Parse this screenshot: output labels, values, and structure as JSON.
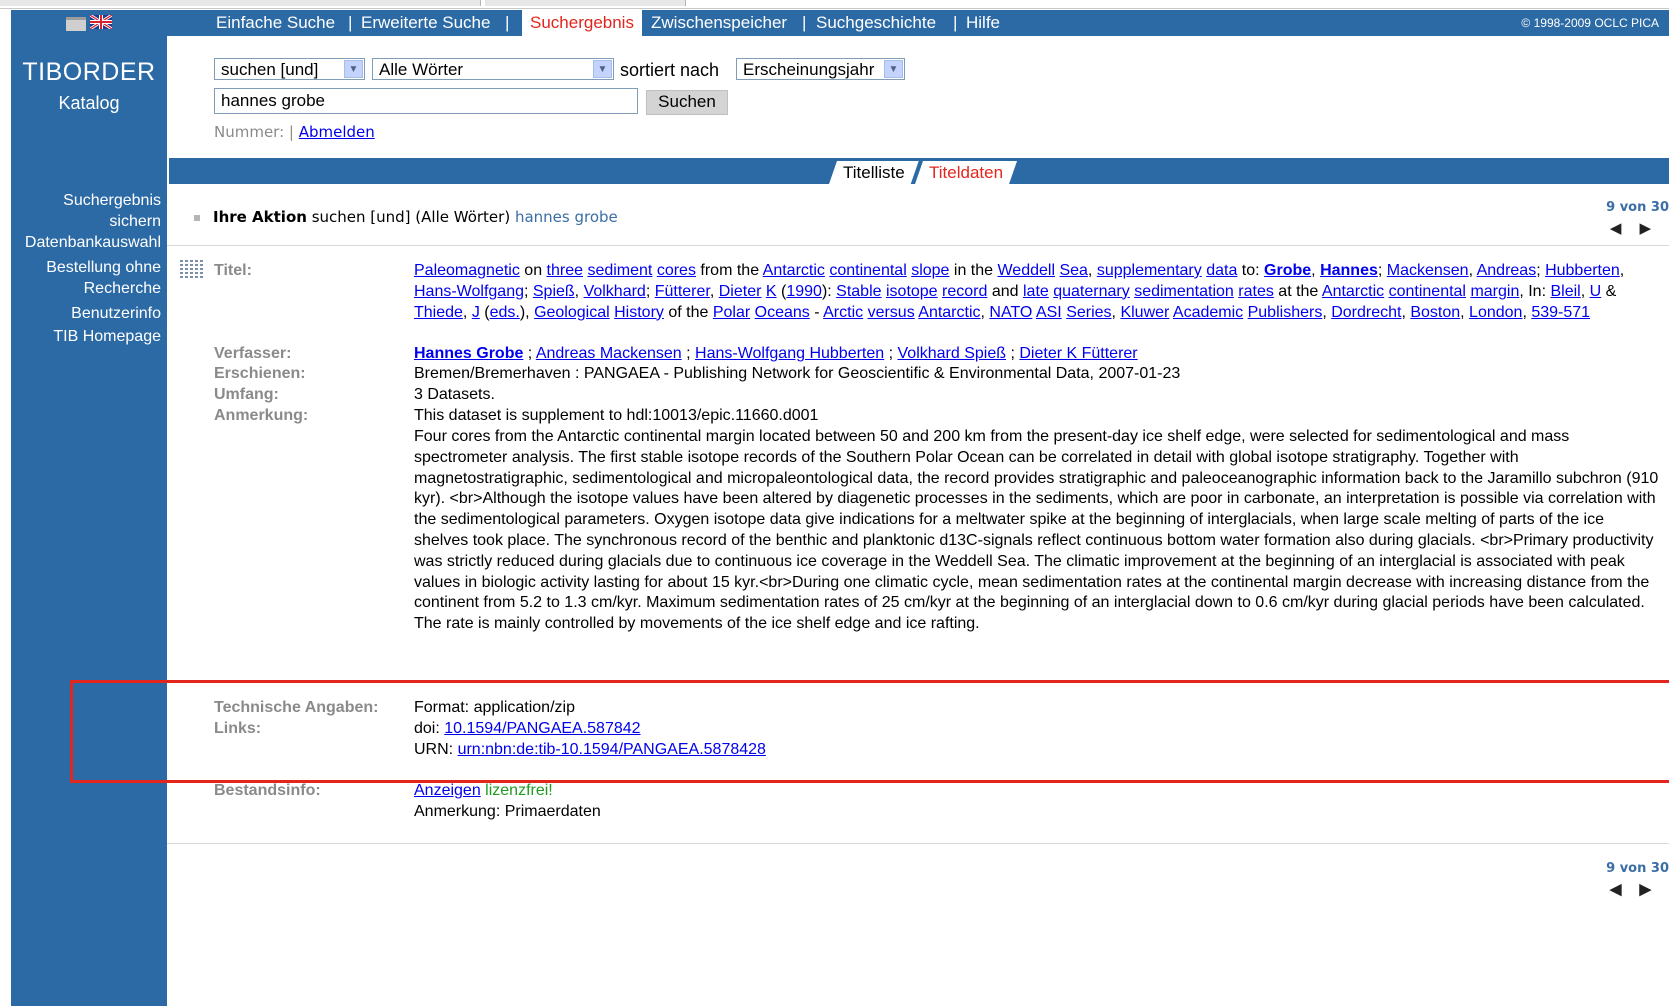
{
  "header": {
    "nav": [
      "Einfache Suche",
      "Erweiterte Suche",
      "Suchergebnis",
      "Zwischenspeicher",
      "Suchgeschichte",
      "Hilfe"
    ],
    "active_nav": "Suchergebnis",
    "copyright": "© 1998-2009 OCLC PICA"
  },
  "brand": {
    "title": "TIBORDER",
    "subtitle": "Katalog"
  },
  "search": {
    "op_select": "suchen [und]",
    "field_select": "Alle Wörter",
    "sort_label": "sortiert nach",
    "sort_select": "Erscheinungsjahr",
    "query": "hannes grobe",
    "submit": "Suchen",
    "nummer_label": "Nummer: |",
    "logout": "Abmelden"
  },
  "tabs": {
    "list": "Titelliste",
    "details": "Titeldaten"
  },
  "sidebar": {
    "items": [
      "Suchergebnis sichern",
      "Datenbankauswahl",
      "Bestellung ohne Recherche",
      "Benutzerinfo",
      "TIB Homepage"
    ]
  },
  "action": {
    "label": "Ihre Aktion",
    "text": "suchen [und] (Alle Wörter)",
    "query": "hannes grobe"
  },
  "pager": {
    "position": "9 von 30",
    "prev": "◀",
    "next": "▶"
  },
  "record": {
    "labels": {
      "titel": "Titel:",
      "verfasser": "Verfasser:",
      "erschienen": "Erschienen:",
      "umfang": "Umfang:",
      "anmerkung": "Anmerkung:",
      "technische": "Technische Angaben:",
      "links": "Links:",
      "bestand": "Bestandsinfo:"
    },
    "erschienen": "Bremen/Bremerhaven : PANGAEA - Publishing Network for Geoscientific & Environmental Data, 2007-01-23",
    "umfang": "3 Datasets.",
    "anmerkung_1": "This dataset is supplement to hdl:10013/epic.11660.d001",
    "anmerkung_2": "Four cores from the Antarctic continental margin located between 50 and 200 km from the present-day ice shelf edge, were selected for sedimentological and mass spectrometer analysis. The first stable isotope records of the Southern Polar Ocean can be correlated in detail with global isotope stratigraphy. Together with magnetostratigraphic, sedimentological and micropaleontological data, the record provides stratigraphic and paleoceanographic information back to the Jaramillo subchron (910 kyr). <br>Although the isotope values have been altered by diagenetic processes in the sediments, which are poor in carbonate, an interpretation is possible via correlation with the sedimentological parameters. Oxygen isotope data give indications for a meltwater spike at the beginning of interglacials, when large scale melting of parts of the ice shelves took place. The synchronous record of the benthic and planktonic d13C-signals reflect continuous bottom water formation also during glacials. <br>Primary productivity was strictly reduced during glacials due to continuous ice coverage in the Weddell Sea. The climatic improvement at the beginning of an interglacial is associated with peak values in biologic activity lasting for about 15 kyr.<br>During one climatic cycle, mean sedimentation rates at the continental margin decrease with increasing distance from the continent from 5.2 to 1.3 cm/kyr. Maximum sedimentation rates of 25 cm/kyr at the beginning of an interglacial down to 0.6 cm/kyr during glacial periods have been calculated. The rate is mainly controlled by movements of the ice shelf edge and ice rafting.",
    "technische": "Format: application/zip",
    "doi_label": "doi:",
    "doi": "10.1594/PANGAEA.587842",
    "urn_label": "URN:",
    "urn": "urn:nbn:de:tib-10.1594/PANGAEA.5878428",
    "bestand_link": "Anzeigen",
    "bestand_free": "lizenzfrei!",
    "bestand_note": "Anmerkung: Primaerdaten"
  }
}
